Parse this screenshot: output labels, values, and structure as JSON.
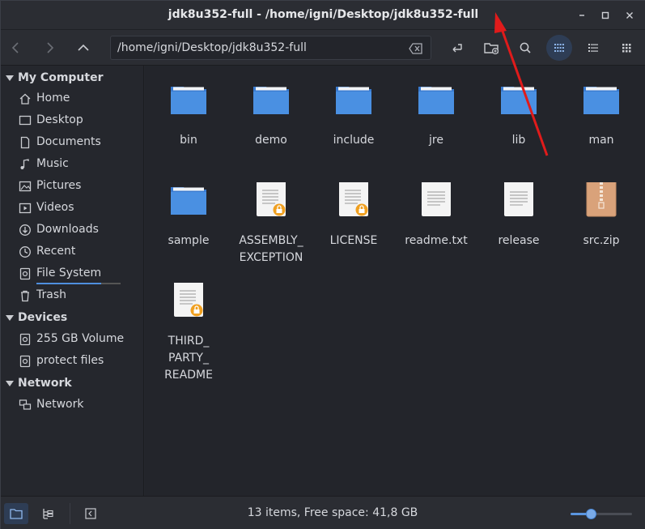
{
  "window": {
    "title": "jdk8u352-full - /home/igni/Desktop/jdk8u352-full",
    "minimize_glyph": "✕",
    "accent": "#4f8fde"
  },
  "toolbar": {
    "path": "/home/igni/Desktop/jdk8u352-full",
    "icons": [
      "back-icon",
      "forward-icon",
      "up-icon",
      "clear-text-icon",
      "swap-icon",
      "new-folder-icon",
      "search-icon",
      "icon-view-icon",
      "list-view-icon",
      "compact-view-icon"
    ]
  },
  "sidebar": {
    "sections": [
      {
        "label": "My Computer",
        "items": [
          {
            "label": "Home",
            "icon": "home-icon"
          },
          {
            "label": "Desktop",
            "icon": "desktop-icon"
          },
          {
            "label": "Documents",
            "icon": "documents-icon"
          },
          {
            "label": "Music",
            "icon": "music-icon"
          },
          {
            "label": "Pictures",
            "icon": "pictures-icon"
          },
          {
            "label": "Videos",
            "icon": "videos-icon"
          },
          {
            "label": "Downloads",
            "icon": "downloads-icon"
          },
          {
            "label": "Recent",
            "icon": "recent-icon"
          },
          {
            "label": "File System",
            "icon": "drive-icon"
          },
          {
            "label": "Trash",
            "icon": "trash-icon"
          }
        ]
      },
      {
        "label": "Devices",
        "items": [
          {
            "label": "255 GB Volume",
            "icon": "drive-icon"
          },
          {
            "label": "protect files",
            "icon": "drive-icon"
          }
        ]
      },
      {
        "label": "Network",
        "items": [
          {
            "label": "Network",
            "icon": "network-icon"
          }
        ]
      }
    ]
  },
  "files": [
    {
      "name": "bin",
      "type": "folder"
    },
    {
      "name": "demo",
      "type": "folder"
    },
    {
      "name": "include",
      "type": "folder"
    },
    {
      "name": "jre",
      "type": "folder"
    },
    {
      "name": "lib",
      "type": "folder"
    },
    {
      "name": "man",
      "type": "folder"
    },
    {
      "name": "sample",
      "type": "folder"
    },
    {
      "name": "ASSEMBLY_\nEXCEPTION",
      "type": "locked-text"
    },
    {
      "name": "LICENSE",
      "type": "locked-text"
    },
    {
      "name": "readme.txt",
      "type": "text"
    },
    {
      "name": "release",
      "type": "text"
    },
    {
      "name": "src.zip",
      "type": "archive"
    },
    {
      "name": "THIRD_\nPARTY_\nREADME",
      "type": "locked-text"
    }
  ],
  "status": {
    "text": "13 items, Free space: 41,8 GB",
    "zoom_level": 0.33
  },
  "colors": {
    "folder": "#4a90e2",
    "lock_badge": "#f0a020",
    "annotation_arrow": "#e01b1b"
  }
}
